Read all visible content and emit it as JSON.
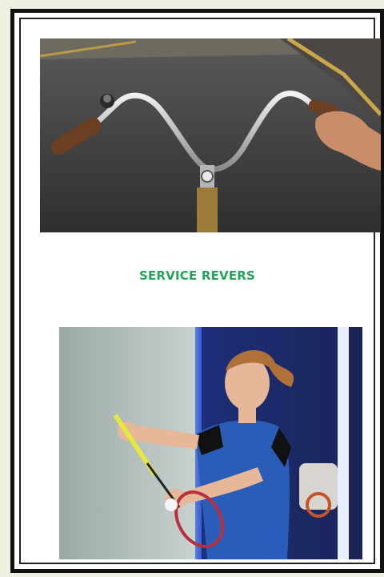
{
  "page": {
    "caption": "SERVICE REVERS"
  },
  "images": {
    "top": {
      "subject": "bicycle-handlebar-photo"
    },
    "bottom": {
      "subject": "badminton-player-serve-photo"
    }
  },
  "colors": {
    "caption": "#26a35a",
    "frame": "#111111",
    "background": "#eef2e0"
  }
}
